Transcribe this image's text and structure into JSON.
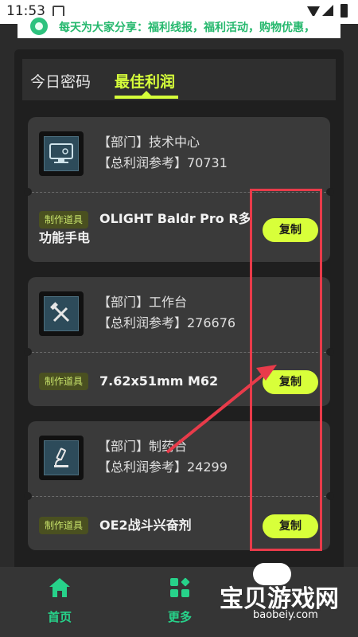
{
  "status_bar": {
    "time": "11:53"
  },
  "banner": {
    "text": "每天为大家分享：福利线报，福利活动，购物优惠，"
  },
  "tabs": [
    {
      "label": "今日密码",
      "active": false
    },
    {
      "label": "最佳利润",
      "active": true
    }
  ],
  "cards": [
    {
      "dept": "【部门】技术中心",
      "profit": "【总利润参考】70731",
      "tag": "制作道具",
      "item": "OLIGHT Baldr Pro R多功能手电",
      "copy_label": "复制",
      "icon": "monitor-icon"
    },
    {
      "dept": "【部门】工作台",
      "profit": "【总利润参考】276676",
      "tag": "制作道具",
      "item": "7.62x51mm M62",
      "copy_label": "复制",
      "icon": "tools-icon"
    },
    {
      "dept": "【部门】制药台",
      "profit": "【总利润参考】24299",
      "tag": "制作道具",
      "item": "OE2战斗兴奋剂",
      "copy_label": "复制",
      "icon": "microscope-icon"
    }
  ],
  "bottom_nav": [
    {
      "label": "首页",
      "icon": "home-icon"
    },
    {
      "label": "更多",
      "icon": "more-icon"
    }
  ],
  "watermark": {
    "title": "宝贝游戏网",
    "subtitle": "baobeiy.com"
  },
  "colors": {
    "accent": "#d8ff3a",
    "nav_green": "#27d28a",
    "annotation_red": "#e83b4a"
  }
}
